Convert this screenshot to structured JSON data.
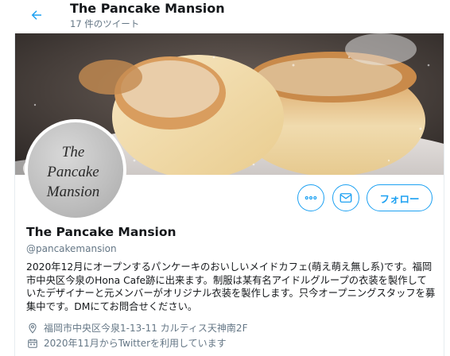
{
  "header": {
    "title": "The Pancake Mansion",
    "tweet_count": "17 件のツイート"
  },
  "avatar": {
    "logo_text": [
      "The",
      "Pancake",
      "Mansion"
    ]
  },
  "actions": {
    "follow_label": "フォロー"
  },
  "profile": {
    "name": "The Pancake Mansion",
    "handle": "@pancakemansion",
    "bio": "2020年12月にオープンするパンケーキのおいしいメイドカフェ(萌え萌え無し系)です。福岡市中央区今泉のHona Cafe跡に出来ます。制服は某有名アイドルグループの衣装を製作していたデザイナーと元メンバーがオリジナル衣装を製作します。只今オープニングスタッフを募集中です。DMにてお問合せください。",
    "location": "福岡市中央区今泉1-13-11 カルティス天神南2F",
    "joined": "2020年11月からTwitterを利用しています"
  },
  "icons": {
    "back": "arrow-left-icon",
    "more": "more-dots-icon",
    "message": "envelope-icon",
    "location": "location-pin-icon",
    "calendar": "calendar-icon"
  },
  "colors": {
    "accent": "#1da1f2",
    "secondary_text": "#657786"
  }
}
